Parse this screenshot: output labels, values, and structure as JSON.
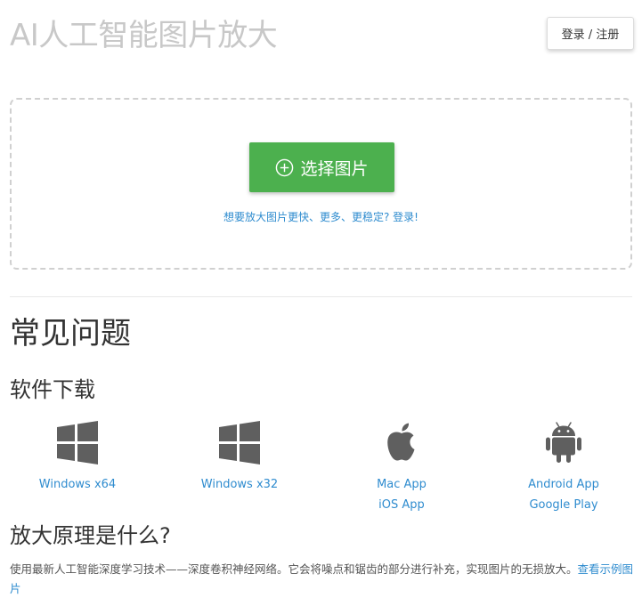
{
  "header": {
    "title": "AI人工智能图片放大",
    "login_label": "登录 / 注册"
  },
  "upload": {
    "select_label": "选择图片",
    "select_icon": "plus-circle-icon",
    "hint_link": "想要放大图片更快、更多、更稳定? 登录!",
    "button_color": "#4cb04e"
  },
  "faq": {
    "title": "常见问题"
  },
  "downloads": {
    "title": "软件下载",
    "items": [
      {
        "icon": "windows-icon",
        "links": [
          "Windows x64"
        ]
      },
      {
        "icon": "windows-icon",
        "links": [
          "Windows x32"
        ]
      },
      {
        "icon": "apple-icon",
        "links": [
          "Mac App",
          "iOS App"
        ]
      },
      {
        "icon": "android-icon",
        "links": [
          "Android App",
          "Google Play"
        ]
      }
    ]
  },
  "principle": {
    "title": "放大原理是什么?",
    "text": "使用最新人工智能深度学习技术——深度卷积神经网络。它会将噪点和锯齿的部分进行补充，实现图片的无损放大。",
    "link": "查看示例图片"
  },
  "colors": {
    "link": "#2f8ccf",
    "title_muted": "#c8c8c8",
    "icon": "#5f5f5f"
  }
}
